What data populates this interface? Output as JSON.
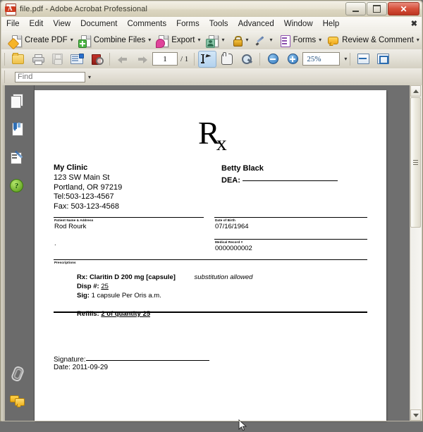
{
  "window": {
    "title": "file.pdf - Adobe Acrobat Professional",
    "app_icon": "pdf-icon",
    "buttons": {
      "minimize": "minimize",
      "maximize": "maximize",
      "close": "close"
    }
  },
  "menubar": {
    "items": [
      "File",
      "Edit",
      "View",
      "Document",
      "Comments",
      "Forms",
      "Tools",
      "Advanced",
      "Window",
      "Help"
    ],
    "close_doc_label": "✖"
  },
  "toolbar_main": {
    "buttons": [
      {
        "label": "Create PDF",
        "icon": "create-pdf-icon",
        "caret": "▾"
      },
      {
        "label": "Combine Files",
        "icon": "combine-files-icon",
        "caret": "▾"
      },
      {
        "label": "Export",
        "icon": "export-icon",
        "caret": "▾"
      },
      {
        "label": "",
        "icon": "start-meeting-icon",
        "caret": "▾"
      },
      {
        "label": "",
        "icon": "secure-lock-icon",
        "caret": "▾"
      },
      {
        "label": "",
        "icon": "sign-pen-icon",
        "caret": "▾"
      },
      {
        "label": "Forms",
        "icon": "forms-icon",
        "caret": "▾"
      },
      {
        "label": "Review & Comment",
        "icon": "review-comment-icon",
        "caret": "▾"
      }
    ]
  },
  "toolbar_file": {
    "open": "open-folder-icon",
    "print": "print-icon",
    "save": "save-floppy-icon",
    "email": "email-icon",
    "search": "search-document-icon",
    "prev_page": "previous-page-arrow-icon",
    "next_page": "next-page-arrow-icon",
    "page_number": "1",
    "page_total": "/ 1",
    "select_tool": "select-text-cursor-icon",
    "hand_tool": "hand-tool-icon",
    "marquee_zoom": "marquee-zoom-icon",
    "zoom_out": "zoom-out-icon",
    "zoom_in": "zoom-in-icon",
    "zoom_value": "25%",
    "zoom_caret": "▾",
    "fit_width": "fit-width-icon",
    "fit_page": "fit-page-icon"
  },
  "findbar": {
    "placeholder": "Find",
    "value": "",
    "caret": "▾"
  },
  "navpane": {
    "items": [
      {
        "name": "pages-panel",
        "icon": "pages-icon"
      },
      {
        "name": "bookmarks-panel",
        "icon": "bookmarks-icon"
      },
      {
        "name": "signatures-panel",
        "icon": "signatures-pen-icon"
      },
      {
        "name": "how-to-panel",
        "icon": "help-question-icon",
        "glyph": "?"
      },
      {
        "name": "attachments-panel",
        "icon": "paperclip-icon"
      },
      {
        "name": "comments-panel",
        "icon": "comments-bubbles-icon"
      }
    ]
  },
  "document": {
    "rx_symbol": "R",
    "rx_subscript": "x",
    "clinic_name": "My Clinic",
    "clinic_address_line1": "123 SW Main St",
    "clinic_address_line2": "Portland, OR 97219",
    "clinic_tel": "Tel:503-123-4567",
    "clinic_fax": "Fax: 503-123-4568",
    "doctor_name": "Betty Black",
    "dea_label": "DEA:",
    "fields": {
      "patient_label": "Patient Name & Address",
      "patient_value": "Rod Rourk",
      "patient_value_line2": ".",
      "dob_label": "Date of Birth",
      "dob_value": "07/16/1964",
      "mrn_label": "Medical Record #",
      "mrn_value": "0000000002",
      "prescriptions_label": "Prescriptions"
    },
    "prescription": {
      "rx_line": "Rx: Claritin D 200 mg [capsule]",
      "substitution": "substitution allowed",
      "disp_label": "Disp #:",
      "disp_value": "25",
      "sig_label": "Sig:",
      "sig_value": "1 capsule Per Oris a.m.",
      "refills_label": "Refills:",
      "refills_value": "2 of quantity 25"
    },
    "signature_label": "Signature:",
    "date_line": "Date: 2011-09-29"
  },
  "scrollbar": {
    "up_arrow": "scroll-up-arrow",
    "down_arrow": "scroll-down-arrow",
    "thumb": "scroll-thumb"
  }
}
